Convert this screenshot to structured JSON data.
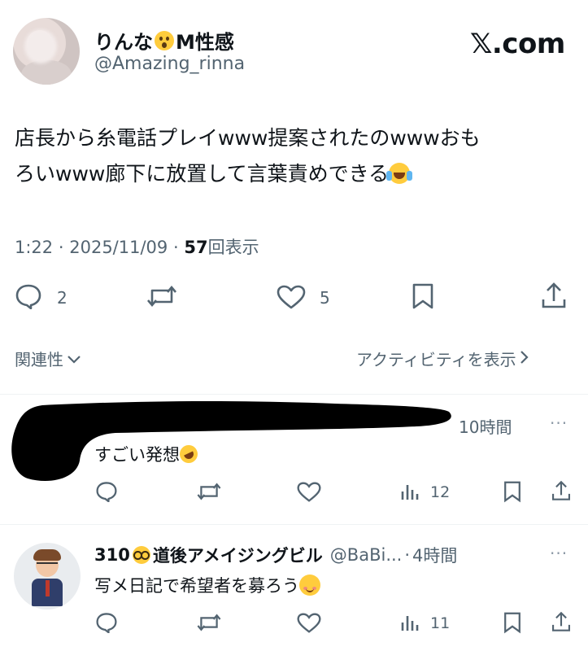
{
  "post": {
    "author_name": "りんな",
    "author_name_suffix": "M性感",
    "handle": "@Amazing_rinna",
    "brand": "𝕏.com",
    "text_line1": "店長から糸電話プレイwww提案されたのwwwおも",
    "text_line2": "ろいwww廊下に放置して言葉責めできる",
    "time": "1:22",
    "date": "2025/11/09",
    "views_count": "57",
    "views_label": "回表示",
    "separator": "·",
    "replies": "2",
    "likes": "5"
  },
  "filters": {
    "relevance_label": "関連性",
    "activity_label": "アクティビティを表示"
  },
  "replies": [
    {
      "time": "10時間",
      "text": "すごい発想",
      "views": "12",
      "more": "···"
    },
    {
      "name_prefix": "310",
      "name_suffix": "道後アメイジングビル",
      "handle": "@BaBi...",
      "separator": "·",
      "time": "4時間",
      "text": "写メ日記で希望者を募ろう",
      "views": "11",
      "more": "···"
    }
  ],
  "colors": {
    "text_primary": "#0f1419",
    "text_secondary": "#536471",
    "divider": "#eff3f4",
    "emoji_yellow": "#ffcc3d"
  },
  "icons": [
    "reply-icon",
    "retweet-icon",
    "like-icon",
    "bookmark-icon",
    "share-icon",
    "views-icon",
    "chevron-down-icon",
    "chevron-right-icon",
    "more-icon"
  ]
}
